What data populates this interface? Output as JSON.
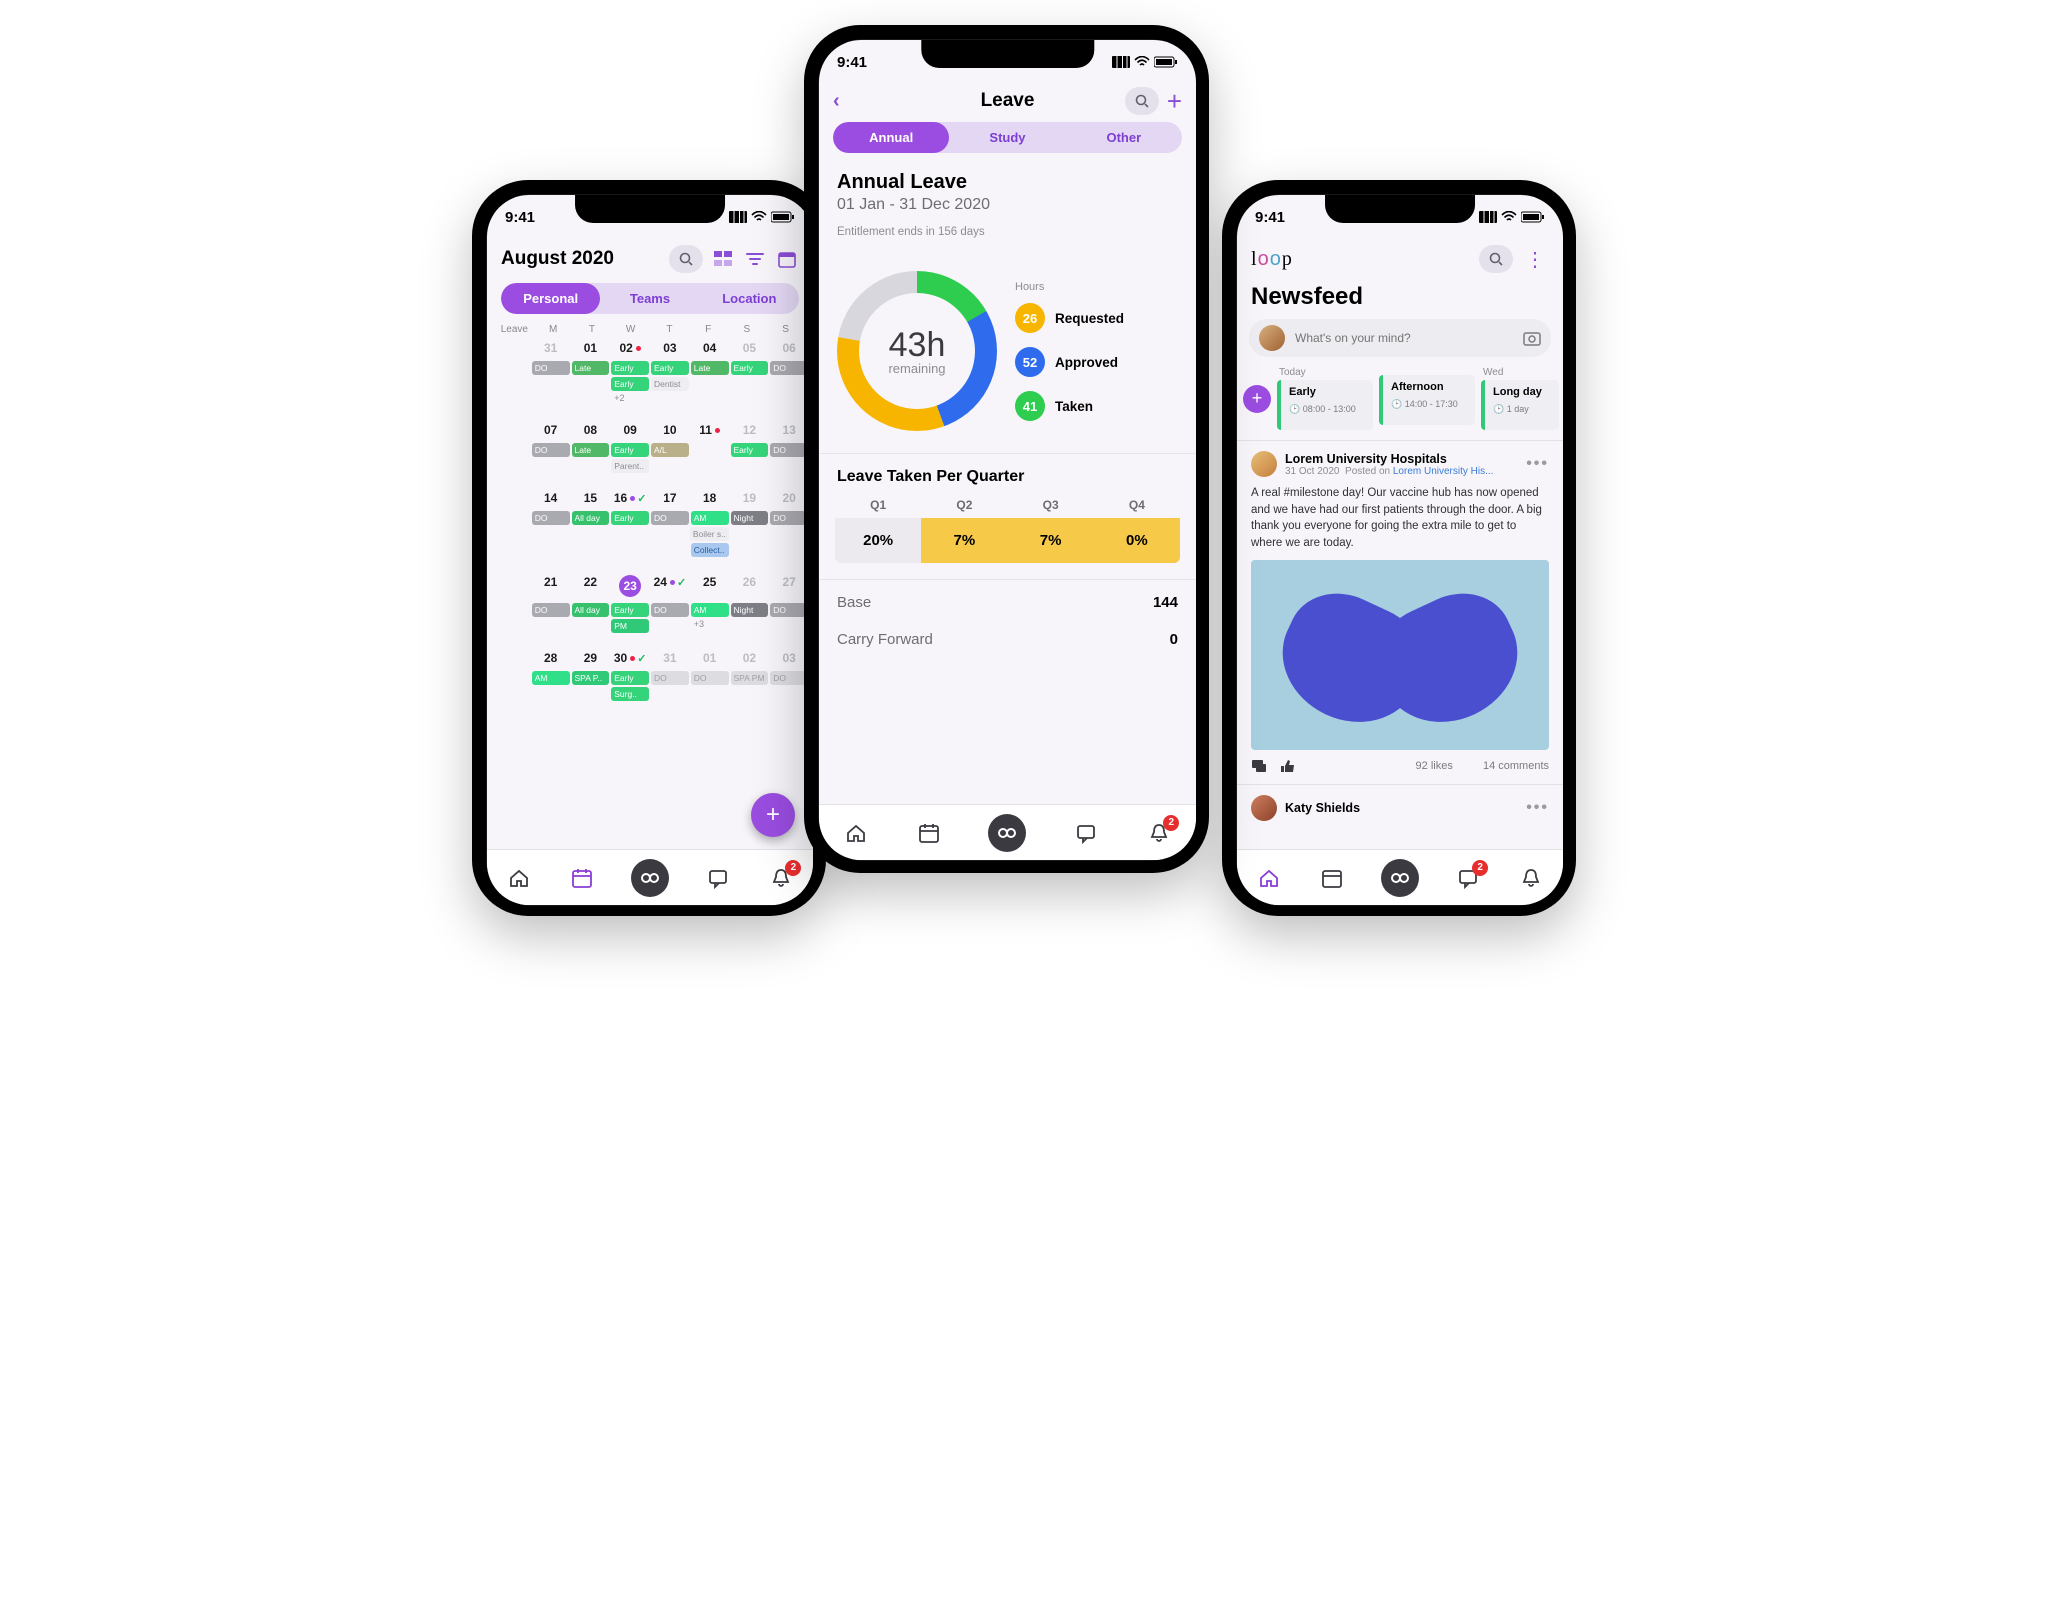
{
  "status_time": "9:41",
  "calendar": {
    "month": "August 2020",
    "tabs": [
      "Personal",
      "Teams",
      "Location"
    ],
    "active_tab": 0,
    "dow": [
      "Leave",
      "M",
      "T",
      "W",
      "T",
      "F",
      "S",
      "S"
    ],
    "weeks": [
      {
        "dates": [
          "31",
          "01",
          "02",
          "03",
          "04",
          "05",
          "06"
        ],
        "dim": [
          0,
          5,
          6
        ],
        "marks": {
          "2": [
            "red"
          ]
        },
        "rows": [
          [
            "DO",
            "Late",
            "Early",
            "Early",
            "Late",
            "Early",
            "DO"
          ],
          [
            "",
            "",
            "Early",
            "Dentist",
            "",
            "",
            ""
          ],
          [
            "",
            "",
            "+2",
            "",
            "",
            "",
            ""
          ]
        ],
        "cls": [
          [
            "g-do",
            "g-late",
            "g-early",
            "g-early",
            "g-late",
            "g-early",
            "g-do"
          ],
          [
            "",
            "",
            "g-early",
            "g-note",
            "",
            "",
            ""
          ],
          [
            "",
            "",
            "plus",
            "",
            "",
            "",
            ""
          ]
        ]
      },
      {
        "dates": [
          "07",
          "08",
          "09",
          "10",
          "11",
          "12",
          "13"
        ],
        "dim": [
          5,
          6
        ],
        "marks": {
          "4": [
            "red"
          ]
        },
        "rows": [
          [
            "DO",
            "Late",
            "Early",
            "A/L",
            "",
            "Early",
            "DO"
          ],
          [
            "",
            "",
            "Parent..",
            "",
            "",
            "",
            ""
          ]
        ],
        "cls": [
          [
            "g-do",
            "g-late",
            "g-early",
            "g-al",
            "",
            "g-early",
            "g-do"
          ],
          [
            "",
            "",
            "g-note",
            "",
            "",
            "",
            ""
          ]
        ]
      },
      {
        "dates": [
          "14",
          "15",
          "16",
          "17",
          "18",
          "19",
          "20"
        ],
        "dim": [
          5,
          6
        ],
        "marks": {
          "2": [
            "pur",
            "check"
          ]
        },
        "rows": [
          [
            "DO",
            "All day",
            "Early",
            "DO",
            "AM",
            "Night",
            "DO"
          ],
          [
            "",
            "",
            "",
            "",
            "Boiler s..",
            "",
            ""
          ],
          [
            "",
            "",
            "",
            "",
            "Collect..",
            "",
            ""
          ]
        ],
        "cls": [
          [
            "g-do",
            "g-allday",
            "g-early",
            "g-do",
            "g-am",
            "g-night",
            "g-do"
          ],
          [
            "",
            "",
            "",
            "",
            "g-note",
            "",
            ""
          ],
          [
            "",
            "",
            "",
            "",
            "g-blue",
            "",
            ""
          ]
        ]
      },
      {
        "dates": [
          "21",
          "22",
          "23",
          "24",
          "25",
          "26",
          "27"
        ],
        "today": 2,
        "dim": [
          5,
          6
        ],
        "marks": {
          "3": [
            "pur",
            "check"
          ]
        },
        "rows": [
          [
            "DO",
            "All day",
            "Early",
            "DO",
            "AM",
            "Night",
            "DO"
          ],
          [
            "",
            "",
            "PM",
            "",
            "+3",
            "",
            ""
          ]
        ],
        "cls": [
          [
            "g-do",
            "g-allday",
            "g-early",
            "g-do",
            "g-am",
            "g-night",
            "g-do"
          ],
          [
            "",
            "",
            "g-pm",
            "",
            "plus",
            "",
            ""
          ]
        ]
      },
      {
        "dates": [
          "28",
          "29",
          "30",
          "31",
          "01",
          "02",
          "03"
        ],
        "dim": [
          3,
          4,
          5,
          6
        ],
        "marks": {
          "2": [
            "red",
            "check"
          ]
        },
        "rows": [
          [
            "AM",
            "SPA P..",
            "Early",
            "DO",
            "DO",
            "SPA PM",
            "DO"
          ],
          [
            "",
            "",
            "Surg..",
            "",
            "",
            "",
            ""
          ]
        ],
        "cls": [
          [
            "g-am",
            "g-spa",
            "g-early",
            "g-faded",
            "g-faded",
            "g-faded",
            "g-faded"
          ],
          [
            "",
            "",
            "g-early",
            "",
            "",
            "",
            ""
          ]
        ]
      }
    ],
    "nav_badge": "2"
  },
  "leave": {
    "title": "Leave",
    "tabs": [
      "Annual",
      "Study",
      "Other"
    ],
    "active_tab": 0,
    "heading": "Annual Leave",
    "range": "01 Jan - 31 Dec 2020",
    "note": "Entitlement ends in 156 days",
    "remaining_value": "43",
    "remaining_unit": "h",
    "remaining_label": "remaining",
    "legend_title": "Hours",
    "legend": [
      {
        "n": "26",
        "label": "Requested",
        "cls": "b-y"
      },
      {
        "n": "52",
        "label": "Approved",
        "cls": "b-b"
      },
      {
        "n": "41",
        "label": "Taken",
        "cls": "b-g"
      }
    ],
    "quarter_title": "Leave Taken Per Quarter",
    "quarters": [
      {
        "h": "Q1",
        "v": "20%",
        "cls": "g"
      },
      {
        "h": "Q2",
        "v": "7%",
        "cls": "y"
      },
      {
        "h": "Q3",
        "v": "7%",
        "cls": "y"
      },
      {
        "h": "Q4",
        "v": "0%",
        "cls": "y"
      }
    ],
    "base_k": "Base",
    "base_v": "144",
    "cf_k": "Carry Forward",
    "cf_v": "0",
    "nav_badge": "2"
  },
  "chart_data": {
    "type": "pie",
    "title": "Annual Leave hours",
    "series": [
      {
        "name": "Hours",
        "values": [
          26,
          52,
          41,
          43
        ]
      }
    ],
    "categories": [
      "Requested",
      "Approved",
      "Taken",
      "Remaining"
    ],
    "center_value": 43,
    "center_unit": "h"
  },
  "feed": {
    "title": "Newsfeed",
    "compose_placeholder": "What's on your mind?",
    "shifts": [
      {
        "day": "Today",
        "name": "Early",
        "time": "08:00 - 13:00"
      },
      {
        "day": "",
        "name": "Afternoon",
        "time": "14:00 - 17:30"
      },
      {
        "day": "Wed",
        "name": "Long day",
        "time": "1 day"
      }
    ],
    "post": {
      "author": "Lorem University Hospitals",
      "date": "31 Oct 2020",
      "posted_prefix": "Posted on ",
      "posted_link": "Lorem University His...",
      "body": "A real #milestone day! Our vaccine hub has now opened and we have had our first patients through the door. A big thank you everyone for going the extra mile to get to where we are today.",
      "likes": "92 likes",
      "comments": "14 comments"
    },
    "next_author": "Katy Shields",
    "nav_badge": "2"
  }
}
